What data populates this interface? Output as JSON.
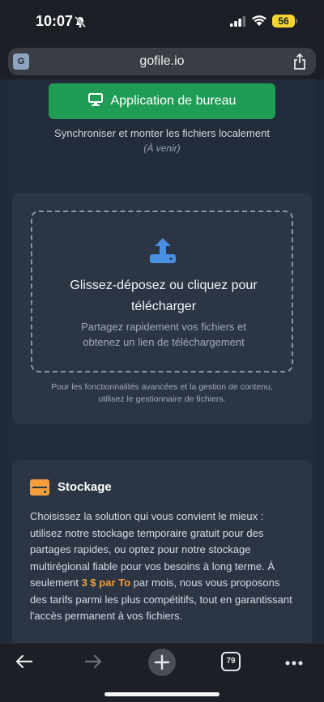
{
  "status_bar": {
    "time": "10:07",
    "battery": "56"
  },
  "browser": {
    "url": "gofile.io",
    "translate_label": "G"
  },
  "desktop_app": {
    "button_label": "Application de bureau",
    "sync_text": "Synchroniser et monter les fichiers localement",
    "coming_soon": "(À venir)"
  },
  "upload": {
    "title_line1": "Glissez-déposez ou cliquez pour",
    "title_line2": "télécharger",
    "subtitle_line1": "Partagez rapidement vos fichiers et",
    "subtitle_line2": "obtenez un lien de téléchargement",
    "advanced_line1": "Pour les fonctionnalités avancées et la gestion de contenu,",
    "advanced_line2": "utilisez le gestionnaire de fichiers."
  },
  "storage": {
    "title": "Stockage",
    "desc_before": "Choisissez la solution qui vous convient le mieux : utilisez notre stockage temporaire gratuit pour des partages rapides, ou optez pour notre stockage multirégional fiable pour vos besoins à long terme. À seulement ",
    "price": "3 $ par To",
    "desc_after": " par mois, nous vous proposons des tarifs parmi les plus compétitifs, tout en garantissant l'accès permanent à vos fichiers."
  },
  "toolbar": {
    "tab_count": "79"
  },
  "colors": {
    "accent_green": "#1f9d55",
    "accent_orange": "#f59e3b",
    "upload_blue": "#4a90e2",
    "battery_yellow": "#f2d533"
  }
}
